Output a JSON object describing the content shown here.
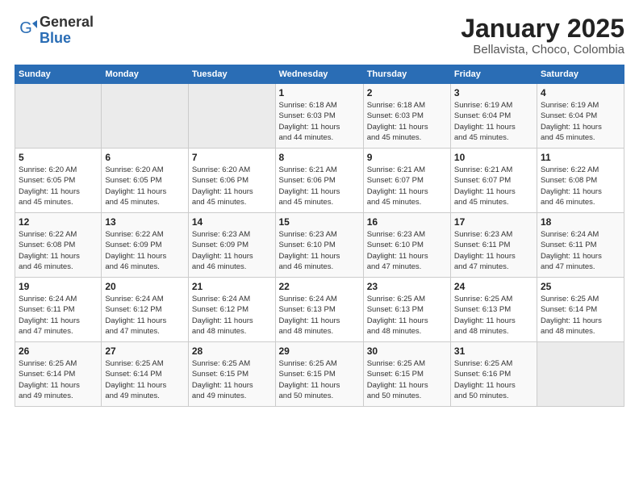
{
  "logo": {
    "general": "General",
    "blue": "Blue"
  },
  "title": {
    "month": "January 2025",
    "location": "Bellavista, Choco, Colombia"
  },
  "weekdays": [
    "Sunday",
    "Monday",
    "Tuesday",
    "Wednesday",
    "Thursday",
    "Friday",
    "Saturday"
  ],
  "weeks": [
    [
      {
        "day": "",
        "info": ""
      },
      {
        "day": "",
        "info": ""
      },
      {
        "day": "",
        "info": ""
      },
      {
        "day": "1",
        "info": "Sunrise: 6:18 AM\nSunset: 6:03 PM\nDaylight: 11 hours\nand 44 minutes."
      },
      {
        "day": "2",
        "info": "Sunrise: 6:18 AM\nSunset: 6:03 PM\nDaylight: 11 hours\nand 45 minutes."
      },
      {
        "day": "3",
        "info": "Sunrise: 6:19 AM\nSunset: 6:04 PM\nDaylight: 11 hours\nand 45 minutes."
      },
      {
        "day": "4",
        "info": "Sunrise: 6:19 AM\nSunset: 6:04 PM\nDaylight: 11 hours\nand 45 minutes."
      }
    ],
    [
      {
        "day": "5",
        "info": "Sunrise: 6:20 AM\nSunset: 6:05 PM\nDaylight: 11 hours\nand 45 minutes."
      },
      {
        "day": "6",
        "info": "Sunrise: 6:20 AM\nSunset: 6:05 PM\nDaylight: 11 hours\nand 45 minutes."
      },
      {
        "day": "7",
        "info": "Sunrise: 6:20 AM\nSunset: 6:06 PM\nDaylight: 11 hours\nand 45 minutes."
      },
      {
        "day": "8",
        "info": "Sunrise: 6:21 AM\nSunset: 6:06 PM\nDaylight: 11 hours\nand 45 minutes."
      },
      {
        "day": "9",
        "info": "Sunrise: 6:21 AM\nSunset: 6:07 PM\nDaylight: 11 hours\nand 45 minutes."
      },
      {
        "day": "10",
        "info": "Sunrise: 6:21 AM\nSunset: 6:07 PM\nDaylight: 11 hours\nand 45 minutes."
      },
      {
        "day": "11",
        "info": "Sunrise: 6:22 AM\nSunset: 6:08 PM\nDaylight: 11 hours\nand 46 minutes."
      }
    ],
    [
      {
        "day": "12",
        "info": "Sunrise: 6:22 AM\nSunset: 6:08 PM\nDaylight: 11 hours\nand 46 minutes."
      },
      {
        "day": "13",
        "info": "Sunrise: 6:22 AM\nSunset: 6:09 PM\nDaylight: 11 hours\nand 46 minutes."
      },
      {
        "day": "14",
        "info": "Sunrise: 6:23 AM\nSunset: 6:09 PM\nDaylight: 11 hours\nand 46 minutes."
      },
      {
        "day": "15",
        "info": "Sunrise: 6:23 AM\nSunset: 6:10 PM\nDaylight: 11 hours\nand 46 minutes."
      },
      {
        "day": "16",
        "info": "Sunrise: 6:23 AM\nSunset: 6:10 PM\nDaylight: 11 hours\nand 47 minutes."
      },
      {
        "day": "17",
        "info": "Sunrise: 6:23 AM\nSunset: 6:11 PM\nDaylight: 11 hours\nand 47 minutes."
      },
      {
        "day": "18",
        "info": "Sunrise: 6:24 AM\nSunset: 6:11 PM\nDaylight: 11 hours\nand 47 minutes."
      }
    ],
    [
      {
        "day": "19",
        "info": "Sunrise: 6:24 AM\nSunset: 6:11 PM\nDaylight: 11 hours\nand 47 minutes."
      },
      {
        "day": "20",
        "info": "Sunrise: 6:24 AM\nSunset: 6:12 PM\nDaylight: 11 hours\nand 47 minutes."
      },
      {
        "day": "21",
        "info": "Sunrise: 6:24 AM\nSunset: 6:12 PM\nDaylight: 11 hours\nand 48 minutes."
      },
      {
        "day": "22",
        "info": "Sunrise: 6:24 AM\nSunset: 6:13 PM\nDaylight: 11 hours\nand 48 minutes."
      },
      {
        "day": "23",
        "info": "Sunrise: 6:25 AM\nSunset: 6:13 PM\nDaylight: 11 hours\nand 48 minutes."
      },
      {
        "day": "24",
        "info": "Sunrise: 6:25 AM\nSunset: 6:13 PM\nDaylight: 11 hours\nand 48 minutes."
      },
      {
        "day": "25",
        "info": "Sunrise: 6:25 AM\nSunset: 6:14 PM\nDaylight: 11 hours\nand 48 minutes."
      }
    ],
    [
      {
        "day": "26",
        "info": "Sunrise: 6:25 AM\nSunset: 6:14 PM\nDaylight: 11 hours\nand 49 minutes."
      },
      {
        "day": "27",
        "info": "Sunrise: 6:25 AM\nSunset: 6:14 PM\nDaylight: 11 hours\nand 49 minutes."
      },
      {
        "day": "28",
        "info": "Sunrise: 6:25 AM\nSunset: 6:15 PM\nDaylight: 11 hours\nand 49 minutes."
      },
      {
        "day": "29",
        "info": "Sunrise: 6:25 AM\nSunset: 6:15 PM\nDaylight: 11 hours\nand 50 minutes."
      },
      {
        "day": "30",
        "info": "Sunrise: 6:25 AM\nSunset: 6:15 PM\nDaylight: 11 hours\nand 50 minutes."
      },
      {
        "day": "31",
        "info": "Sunrise: 6:25 AM\nSunset: 6:16 PM\nDaylight: 11 hours\nand 50 minutes."
      },
      {
        "day": "",
        "info": ""
      }
    ]
  ]
}
